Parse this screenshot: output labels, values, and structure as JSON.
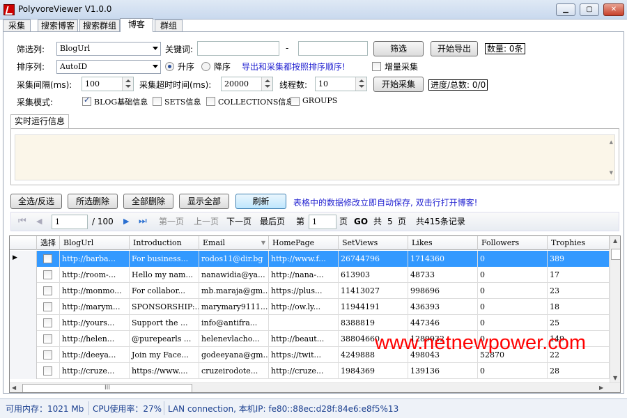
{
  "window": {
    "title": "PolyvoreViewer V1.0.0"
  },
  "tabs": [
    "采集",
    "搜索博客",
    "搜索群组",
    "博客",
    "群组"
  ],
  "active_tab": "博客",
  "filter": {
    "filter_col_label": "筛选列:",
    "filter_col_value": "BlogUrl",
    "keyword_label": "关键词:",
    "dash": "-",
    "filter_button": "筛选",
    "export_button": "开始导出",
    "count_label": "数量: 0条"
  },
  "sort": {
    "sort_col_label": "排序列:",
    "sort_col_value": "AutoID",
    "asc_label": "升序",
    "desc_label": "降序",
    "note": "导出和采集都按照排序顺序!",
    "incremental_label": "增量采集"
  },
  "collect": {
    "interval_label": "采集间隔(ms):",
    "interval_value": "100",
    "timeout_label": "采集超时时间(ms):",
    "timeout_value": "20000",
    "threads_label": "线程数:",
    "threads_value": "10",
    "start_button": "开始采集",
    "progress_label": "进度/总数: 0/0"
  },
  "mode": {
    "label": "采集模式:",
    "options": [
      {
        "label": "BLOG基础信息",
        "checked": true
      },
      {
        "label": "SETS信息",
        "checked": false
      },
      {
        "label": "COLLECTIONS信息",
        "checked": false
      },
      {
        "label": "GROUPS",
        "checked": false
      }
    ]
  },
  "log": {
    "tab_label": "实时运行信息"
  },
  "actions": {
    "select_all": "全选/反选",
    "delete_selected": "所选删除",
    "delete_all": "全部删除",
    "show_all": "显示全部",
    "refresh": "刷新",
    "note": "表格中的数据修改立即自动保存, 双击行打开博客!"
  },
  "pager": {
    "page_value": "1",
    "total_pages": "/ 100",
    "first_page": "第一页",
    "prev_page": "上一页",
    "next_page": "下一页",
    "last_page": "最后页",
    "di": "第",
    "goto_value": "1",
    "ye": "页",
    "go": "GO",
    "gong": "共",
    "pages_count": "5",
    "ye2": "页",
    "records": "共415条记录"
  },
  "table": {
    "columns": [
      "选择",
      "BlogUrl",
      "Introduction",
      "Email",
      "HomePage",
      "SetViews",
      "Likes",
      "Followers",
      "Trophies"
    ],
    "rows": [
      {
        "url": "http://barba...",
        "intro": "For business...",
        "email": "rodos11@dir.bg",
        "home": "http://www.f...",
        "views": "26744796",
        "likes": "1714360",
        "followers": "0",
        "trophies": "389"
      },
      {
        "url": "http://room-...",
        "intro": "Hello my nam...",
        "email": "nanawidia@ya...",
        "home": "http://nana-...",
        "views": "613903",
        "likes": "48733",
        "followers": "0",
        "trophies": "17"
      },
      {
        "url": "http://monmo...",
        "intro": "For collabor...",
        "email": "mb.maraja@gm...",
        "home": "https://plus...",
        "views": "11413027",
        "likes": "998696",
        "followers": "0",
        "trophies": "23"
      },
      {
        "url": "http://marym...",
        "intro": "SPONSORSHIP:...",
        "email": "marymary9111...",
        "home": "http://ow.ly...",
        "views": "11944191",
        "likes": "436393",
        "followers": "0",
        "trophies": "18"
      },
      {
        "url": "http://yours...",
        "intro": "Support the ...",
        "email": "info@antifra...",
        "home": "",
        "views": "8388819",
        "likes": "447346",
        "followers": "0",
        "trophies": "25"
      },
      {
        "url": "http://helen...",
        "intro": "@purepearls ...",
        "email": "helenevlacho...",
        "home": "http://beaut...",
        "views": "38804660",
        "likes": "1289932",
        "followers": "0",
        "trophies": "149"
      },
      {
        "url": "http://deeya...",
        "intro": "Join my Face...",
        "email": "godeeyana@gm...",
        "home": "https://twit...",
        "views": "4249888",
        "likes": "498043",
        "followers": "52870",
        "trophies": "22"
      },
      {
        "url": "http://cruze...",
        "intro": "https://www....",
        "email": "cruzeirodote...",
        "home": "http://cruze...",
        "views": "1984369",
        "likes": "139136",
        "followers": "0",
        "trophies": "28"
      }
    ]
  },
  "hscroll_grip": "III",
  "watermark": "www.netnewpower.com",
  "status": {
    "memory": "可用内存：1021 Mb",
    "cpu": "CPU使用率：27%",
    "network": "LAN connection, 本机IP: fe80::88ec:d28f:84e6:e8f5%13"
  },
  "colors": {
    "selection": "#3399ff",
    "note_blue": "#1f1fd0",
    "watermark_red": "#ff0000",
    "status_text": "#1a3f8f"
  }
}
